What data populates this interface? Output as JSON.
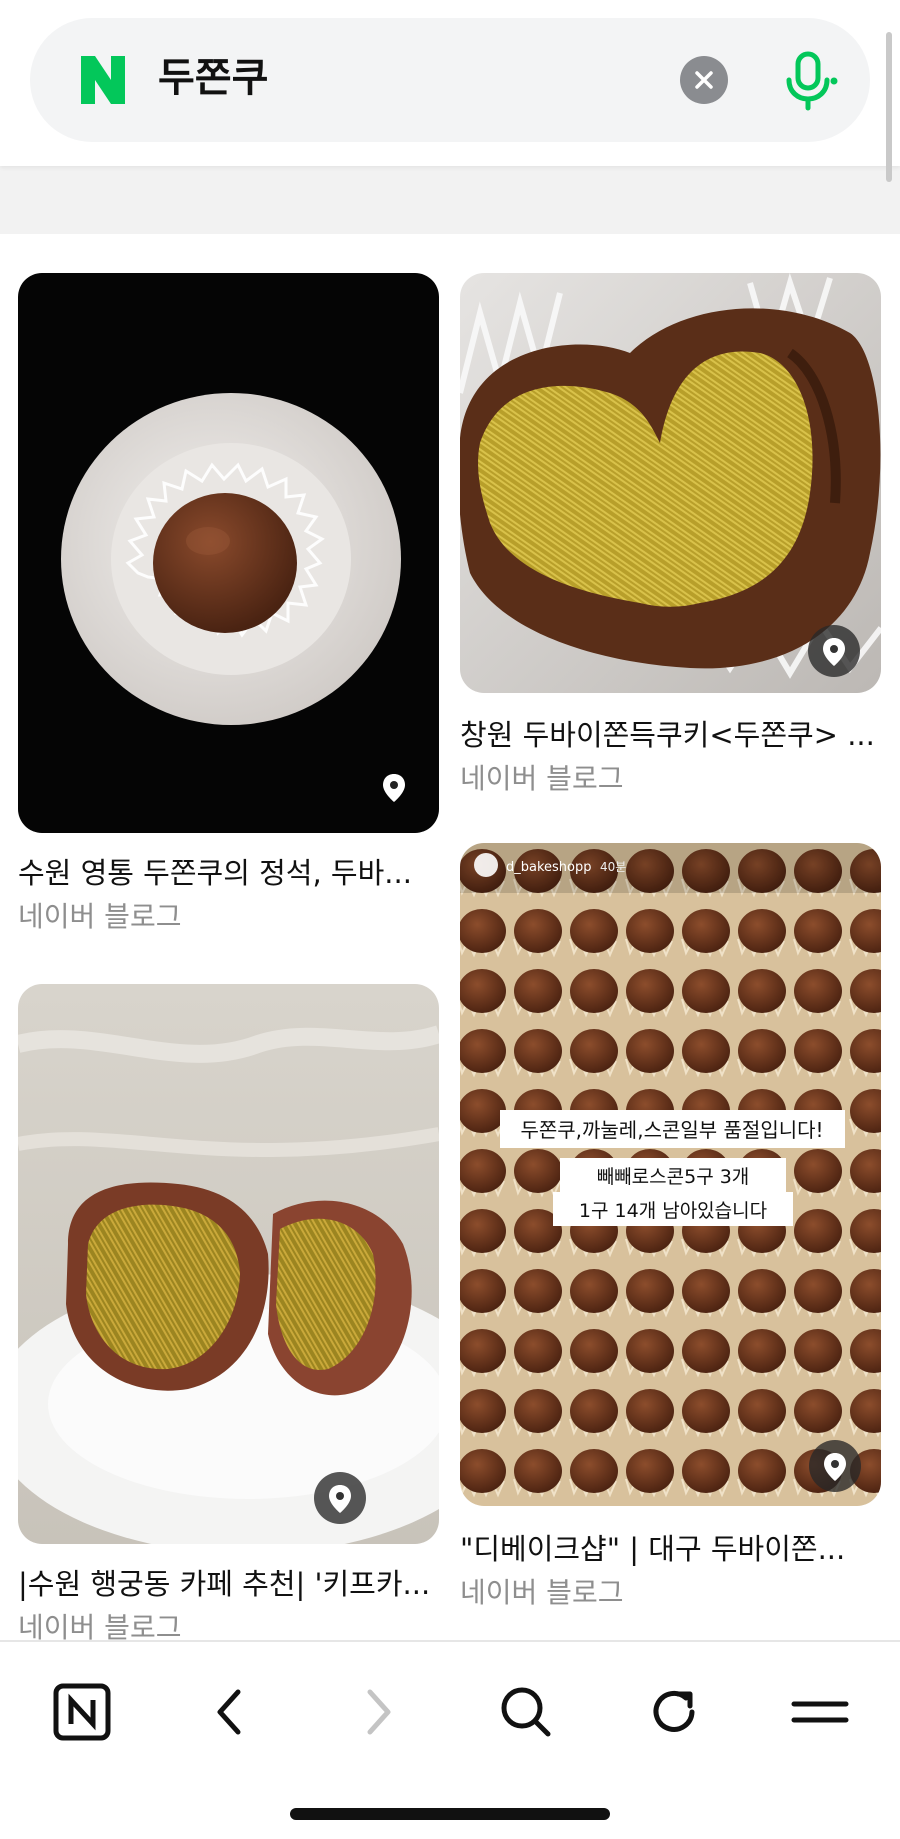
{
  "search": {
    "query": "두쫀쿠",
    "logo_letter": "N",
    "brand_color": "#03c75a"
  },
  "results": [
    {
      "title": "수원 영통 두쫀쿠의 정석, 두바...",
      "source": "네이버 블로그"
    },
    {
      "title": "창원 두바이쫀득쿠키<두쫀쿠> ...",
      "source": "네이버 블로그"
    },
    {
      "title": "|수원 행궁동 카페 추천| '키프카...",
      "source": "네이버 블로그"
    },
    {
      "title": "\"디베이크샵\" | 대구 두바이쫀...",
      "source": "네이버 블로그",
      "overlay": {
        "account": "d_bakeshopp",
        "time": "40분",
        "line1": "두쫀쿠,까눌레,스콘일부 품절입니다!",
        "line2": "빼빼로스콘5구 3개",
        "line3": "1구 14개 남아있습니다"
      }
    }
  ],
  "nav": {
    "icons": [
      "naver-home-icon",
      "back-icon",
      "forward-icon",
      "search-icon",
      "refresh-icon",
      "menu-icon"
    ],
    "home_letter": "N"
  }
}
